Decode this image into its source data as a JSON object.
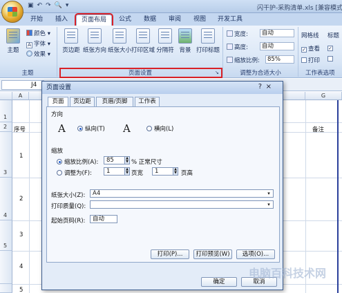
{
  "window": {
    "title": "闪干护-采购清单.xls  [兼容模式]"
  },
  "ribbon_tabs": [
    "开始",
    "插入",
    "页面布局",
    "公式",
    "数据",
    "审阅",
    "视图",
    "开发工具"
  ],
  "ribbon": {
    "theme_group": {
      "label": "主题",
      "theme_button": "主题",
      "colors": "颜色",
      "fonts": "字体",
      "effects": "效果"
    },
    "page_setup_group": {
      "label": "页面设置",
      "buttons": [
        "页边距",
        "纸张方向",
        "纸张大小",
        "打印区域",
        "分隔符",
        "背景",
        "打印标题"
      ]
    },
    "scale_group": {
      "label": "调整为合适大小",
      "width_label": "宽度:",
      "width_value": "自动",
      "height_label": "高度:",
      "height_value": "自动",
      "scale_label": "缩放比例:",
      "scale_value": "85%"
    },
    "sheet_options_group": {
      "label": "工作表选项",
      "gridlines": "网格线",
      "headings": "标题",
      "view": "查看",
      "print": "打印"
    }
  },
  "formula_bar": {
    "name_box": "J4"
  },
  "sheet": {
    "columns": [
      "A",
      "G"
    ],
    "rows": [
      "1",
      "2",
      "3",
      "4",
      "5"
    ],
    "header_cells": {
      "serial": "序号",
      "note": "备注"
    },
    "cells": {
      "r1": "1",
      "r2": "2",
      "r3": "3",
      "r4": "4",
      "r5": "5"
    }
  },
  "dialog": {
    "title": "页面设置",
    "help": "?",
    "close": "×",
    "tabs": [
      "页面",
      "页边距",
      "页眉/页脚",
      "工作表"
    ],
    "orientation": {
      "section": "方向",
      "portrait": "纵向(T)",
      "landscape": "横向(L)",
      "icon_letter": "A"
    },
    "scaling": {
      "section": "缩放",
      "adjust_label": "缩放比例(A):",
      "adjust_value": "85",
      "adjust_suffix": "% 正常尺寸",
      "fit_label": "调整为(F):",
      "fit_wide": "1",
      "fit_wide_suffix": "页宽",
      "fit_tall": "1",
      "fit_tall_suffix": "页高"
    },
    "paper_size_label": "纸张大小(Z):",
    "paper_size_value": "A4",
    "print_quality_label": "打印质量(Q):",
    "print_quality_value": "",
    "first_page_label": "起始页码(R):",
    "first_page_value": "自动",
    "buttons": {
      "print": "打印(P)...",
      "preview": "打印预览(W)",
      "options": "选项(O)...",
      "ok": "确定",
      "cancel": "取消"
    }
  },
  "watermark": "电脑百科技术网",
  "colors": {
    "highlight": "#d92127",
    "ribbon_tab_bg": "#c4d7f0"
  }
}
